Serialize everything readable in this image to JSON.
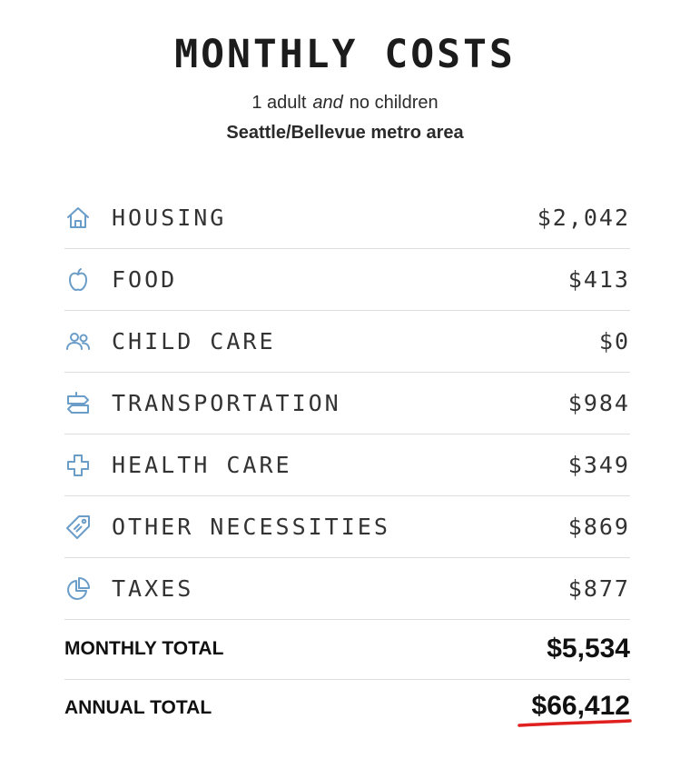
{
  "header": {
    "title": "MONTHLY COSTS",
    "family_adults": "1 adult",
    "family_conjunction": "and",
    "family_children": "no children",
    "region": "Seattle/Bellevue metro area"
  },
  "costs": [
    {
      "icon": "house-icon",
      "label": "HOUSING",
      "amount": "$2,042"
    },
    {
      "icon": "apple-icon",
      "label": "FOOD",
      "amount": "$413"
    },
    {
      "icon": "people-icon",
      "label": "CHILD CARE",
      "amount": "$0"
    },
    {
      "icon": "signpost-icon",
      "label": "TRANSPORTATION",
      "amount": "$984"
    },
    {
      "icon": "medical-cross-icon",
      "label": "HEALTH CARE",
      "amount": "$349"
    },
    {
      "icon": "price-tag-icon",
      "label": "OTHER NECESSITIES",
      "amount": "$869"
    },
    {
      "icon": "pie-chart-icon",
      "label": "TAXES",
      "amount": "$877"
    }
  ],
  "totals": {
    "monthly_label": "MONTHLY TOTAL",
    "monthly_amount": "$5,534",
    "annual_label": "ANNUAL TOTAL",
    "annual_amount": "$66,412"
  },
  "colors": {
    "icon": "#6b9dc9",
    "underline_accent": "#e0201f",
    "divider": "#dedede"
  }
}
